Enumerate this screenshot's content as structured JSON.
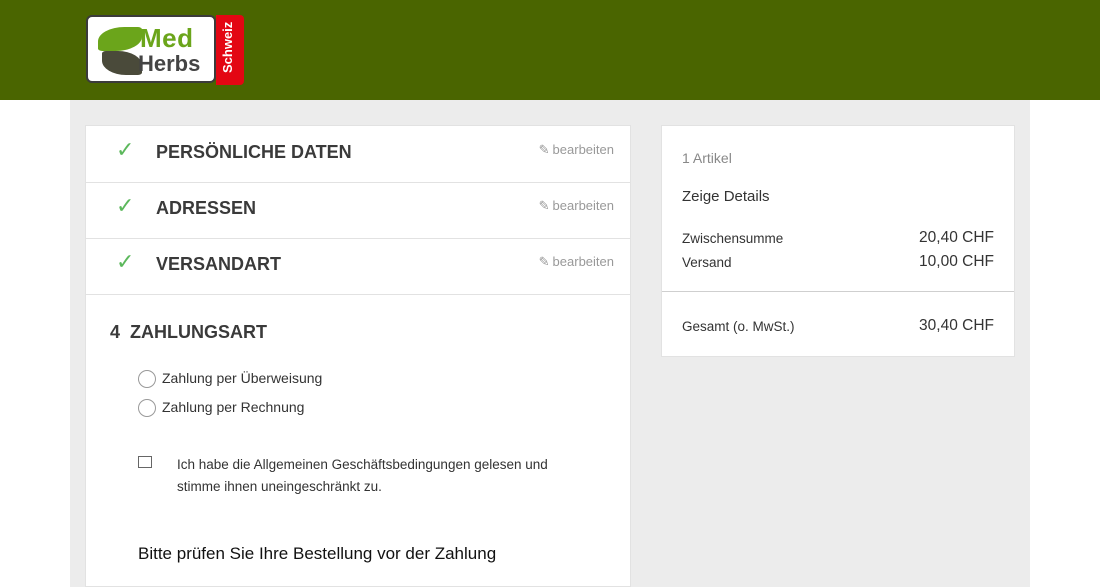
{
  "brand": {
    "name_top": "Med",
    "name_bottom": "Herbs",
    "region": "Schweiz"
  },
  "steps": [
    {
      "label": "PERSÖNLICHE DATEN",
      "edit": "bearbeiten"
    },
    {
      "label": "ADRESSEN",
      "edit": "bearbeiten"
    },
    {
      "label": "VERSANDART",
      "edit": "bearbeiten"
    }
  ],
  "payment": {
    "number": "4",
    "title": "ZAHLUNGSART",
    "options": [
      "Zahlung per Überweisung",
      "Zahlung per Rechnung"
    ],
    "agb_text": "Ich habe die Allgemeinen Geschäftsbedingungen gelesen und stimme ihnen uneingeschränkt zu.",
    "review_heading": "Bitte prüfen Sie Ihre Bestellung vor der Zahlung"
  },
  "summary": {
    "count": "1 Artikel",
    "details_link": "Zeige Details",
    "subtotal_label": "Zwischensumme",
    "subtotal_value": "20,40 CHF",
    "shipping_label": "Versand",
    "shipping_value": "10,00 CHF",
    "total_label": "Gesamt (o. MwSt.)",
    "total_value": "30,40 CHF"
  }
}
